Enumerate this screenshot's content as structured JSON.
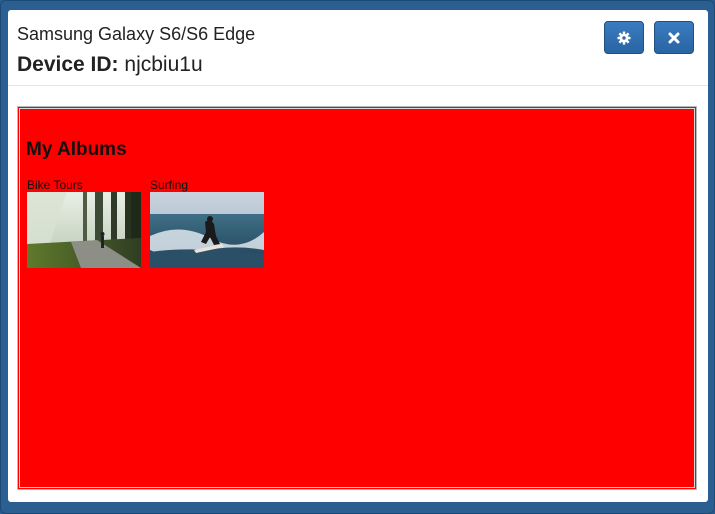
{
  "header": {
    "device_name": "Samsung Galaxy S6/S6 Edge",
    "device_id_label": "Device ID:",
    "device_id_value": "njcbiu1u"
  },
  "toolbar": {
    "settings_icon": "gear-icon",
    "close_icon": "close-icon",
    "accent_color": "#2a64a3"
  },
  "content": {
    "background_color": "#ff0000",
    "title": "My Albums",
    "albums": [
      {
        "label": "Bike Tours",
        "thumbnail": "forest road with sunbeams and cyclist"
      },
      {
        "label": "Surfing",
        "thumbnail": "surfer riding a wave"
      }
    ]
  }
}
